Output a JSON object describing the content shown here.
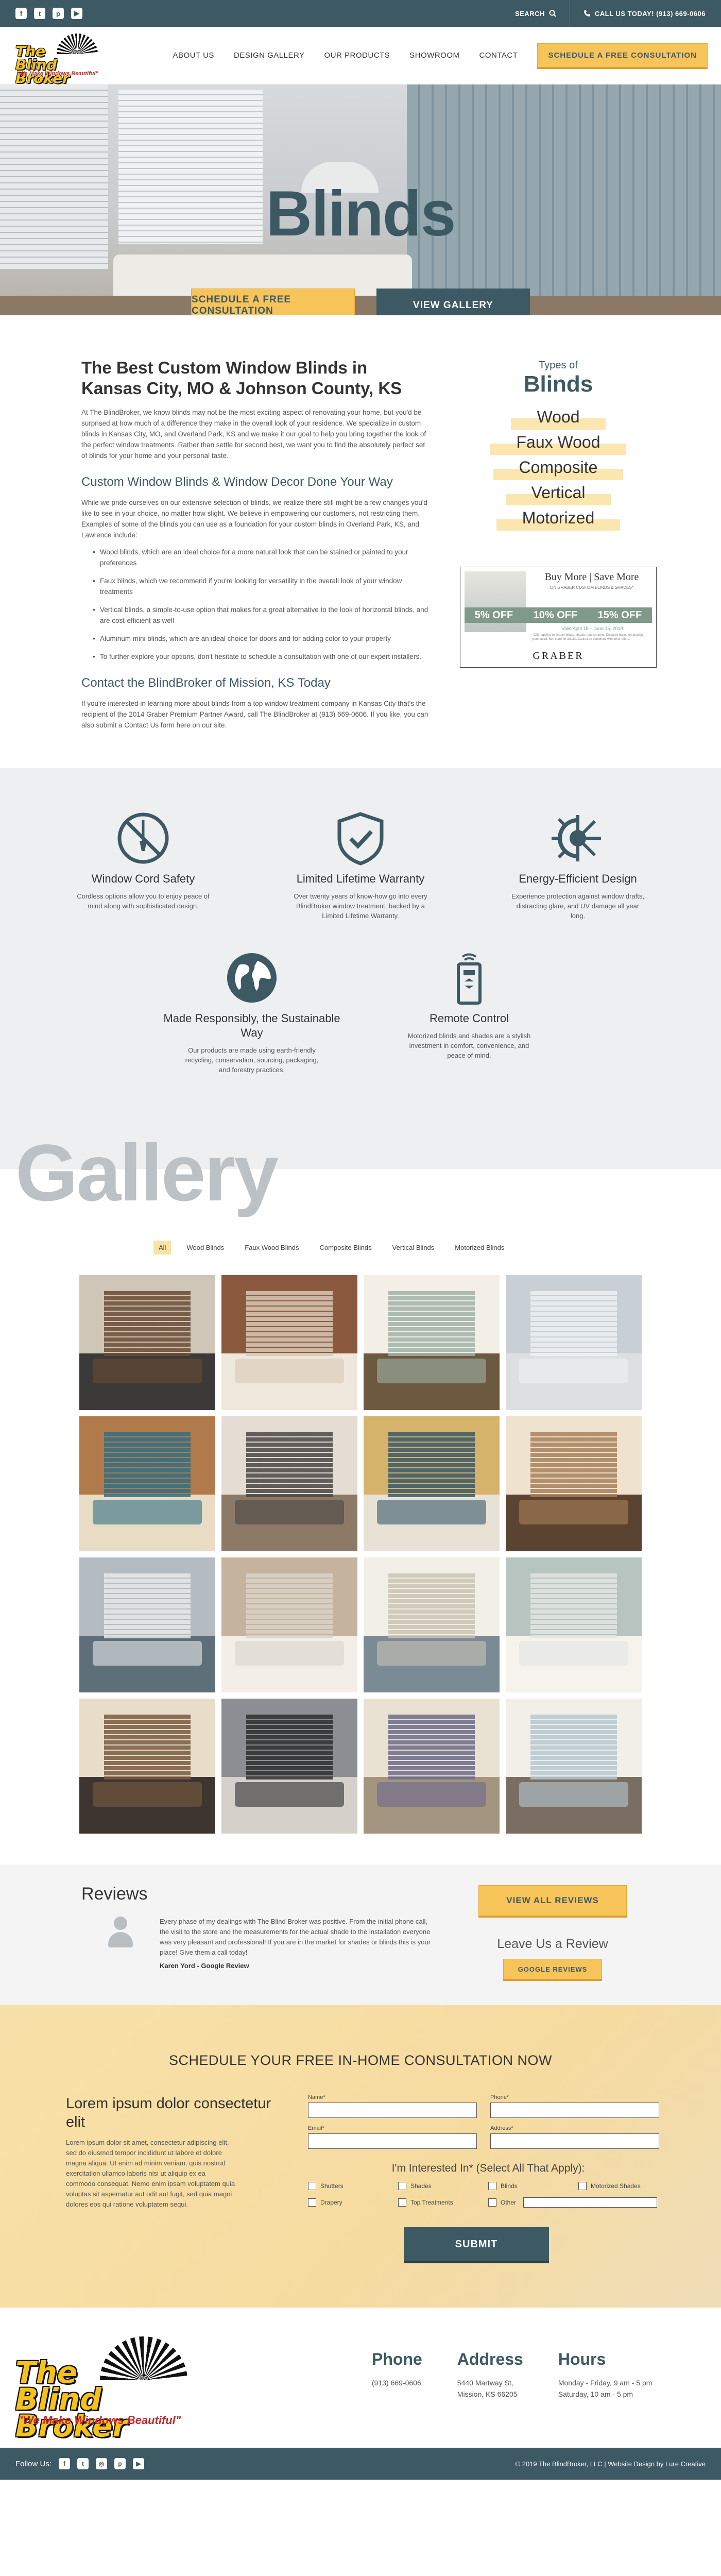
{
  "topbar": {
    "social": [
      "facebook-icon",
      "twitter-icon",
      "pinterest-icon",
      "youtube-icon"
    ],
    "search_label": "SEARCH",
    "call_label": "CALL US TODAY! (913) 669-0606"
  },
  "header": {
    "logo_text": "The Blind Broker",
    "logo_tagline": "\"We Make Windows Beautiful\"",
    "nav": [
      "ABOUT US",
      "DESIGN GALLERY",
      "OUR PRODUCTS",
      "SHOWROOM",
      "CONTACT"
    ],
    "cta": "SCHEDULE A FREE CONSULTATION"
  },
  "hero": {
    "title": "Blinds",
    "btn_primary": "SCHEDULE A FREE CONSULTATION",
    "btn_secondary": "VIEW GALLERY"
  },
  "intro": {
    "heading": "The Best Custom Window Blinds in Kansas City, MO & Johnson County, KS",
    "p1": "At The BlindBroker, we know blinds may not be the most exciting aspect of renovating your home, but you'd be surprised at how much of a difference they make in the overall look of your residence. We specialize in custom blinds in Kansas City, MO, and Overland Park, KS and we make it our goal to help you bring together the look of the perfect window treatments. Rather than settle for second best, we want you to find the absolutely perfect set of blinds for your home and your personal taste.",
    "subheading": "Custom Window Blinds & Window Decor Done Your Way",
    "p2": "While we pride ourselves on our extensive selection of blinds, we realize there still might be a few changes you'd like to see in your choice, no matter how slight. We believe in empowering our customers, not restricting them. Examples of some of the blinds you can use as a foundation for your custom blinds in Overland Park, KS, and Lawrence include:",
    "bullets": [
      "Wood blinds, which are an ideal choice for a more natural look that can be stained or painted to your preferences",
      "Faux blinds, which we recommend if you're looking for versatility in the overall look of your window treatments",
      "Vertical blinds, a simple-to-use option that makes for a great alternative to the look of horizontal blinds, and are cost-efficient as well",
      "Aluminum mini blinds, which are an ideal choice for doors and for adding color to your property",
      "To further explore your options, don't hesitate to schedule a consultation with one of our expert installers."
    ],
    "contact_heading": "Contact the BlindBroker of Mission, KS Today",
    "p3": "If you're interested in learning more about blinds from a top window treatment company in Kansas City that's the recipient of the 2014 Graber Premium Partner Award, call The BlindBroker at (913) 669-0606. If you like, you can also submit a Contact Us form here on our site."
  },
  "sidebar": {
    "eyebrow": "Types of",
    "title": "Blinds",
    "types": [
      "Wood",
      "Faux Wood",
      "Composite",
      "Vertical",
      "Motorized"
    ],
    "ad": {
      "title": "Buy More | Save More",
      "subtitle": "ON GRABER CUSTOM BLINDS & SHADES*",
      "offers": [
        "5% OFF",
        "10% OFF",
        "15% OFF"
      ],
      "dates": "Valid April 15 – June 15, 2019",
      "fine": "*Offer applies to Graber blinds, shades, and shutters. Discount based on quantity purchased. See store for details. Cannot be combined with other offers.",
      "brand": "GRABER"
    }
  },
  "features": [
    {
      "icon": "no-cord-icon",
      "title": "Window Cord Safety",
      "text": "Cordless options allow you to enjoy peace of mind along with sophisticated design."
    },
    {
      "icon": "shield-check-icon",
      "title": "Limited Lifetime Warranty",
      "text": "Over twenty years of know-how go into every BlindBroker window treatment, backed by a Limited Lifetime Warranty."
    },
    {
      "icon": "sun-snowflake-icon",
      "title": "Energy-Efficient Design",
      "text": "Experience protection against window drafts, distracting glare, and UV damage all year long."
    },
    {
      "icon": "globe-icon",
      "title": "Made Responsibly, the Sustainable Way",
      "text": "Our products are made using earth-friendly recycling, conservation, sourcing, packaging, and forestry practices."
    },
    {
      "icon": "remote-icon",
      "title": "Remote Control",
      "text": "Motorized blinds and shades are a stylish investment in comfort, convenience, and peace of mind."
    }
  ],
  "gallery": {
    "title": "Gallery",
    "filters": [
      "All",
      "Wood Blinds",
      "Faux Wood Blinds",
      "Composite Blinds",
      "Vertical Blinds",
      "Motorized Blinds"
    ],
    "active_filter": "All",
    "tile_count": 16
  },
  "reviews": {
    "title": "Reviews",
    "text": "Every phase of my dealings with The Blind Broker was positive. From the initial phone call, the visit to the store and the measurements for the actual shade to the installation everyone was very pleasant and professional! If you are in the market for shades or blinds this is your place! Give them a call today!",
    "author": "Karen Yord - Google Review",
    "view_all": "VIEW ALL REVIEWS",
    "leave": "Leave Us a Review",
    "google": "GOOGLE REVIEWS"
  },
  "consult": {
    "title": "SCHEDULE YOUR FREE IN-HOME CONSULTATION NOW",
    "left_heading": "Lorem ipsum dolor consectetur elit",
    "left_text": "Lorem ipsum dolor sit amet, consectetur adipiscing elit, sed do eiusmod tempor incididunt ut labore et dolore magna aliqua. Ut enim ad minim veniam, quis nostrud exercitation ullamco laboris nisi ut aliquip ex ea commodo consequat. Nemo enim ipsam voluptatem quia voluptas sit aspernatur aut odit aut fugit, sed quia magni dolores eos qui ratione voluptatem sequi.",
    "fields": [
      "Name*",
      "Phone*",
      "Email*",
      "Address*"
    ],
    "interested": "I'm Interested In* (Select All That Apply):",
    "options": [
      "Shutters",
      "Shades",
      "Blinds",
      "Motorized Shades",
      "Drapery",
      "Top Treatments",
      "Other"
    ],
    "submit": "SUBMIT"
  },
  "footer": {
    "phone_title": "Phone",
    "phone": "(913) 669-0606",
    "address_title": "Address",
    "address1": "5440 Martway St,",
    "address2": "Mission, KS 66205",
    "hours_title": "Hours",
    "hours1": "Monday - Friday, 9 am - 5 pm",
    "hours2": "Saturday, 10 am - 5 pm",
    "follow": "Follow Us:",
    "copyright": "© 2019 The BlindBroker, LLC | Website Design by Lure Creative"
  },
  "colors": {
    "brand_dark": "#3d5963",
    "accent_yellow": "#f7c45a",
    "logo_yellow": "#f6c21a",
    "logo_red": "#c0282d"
  }
}
